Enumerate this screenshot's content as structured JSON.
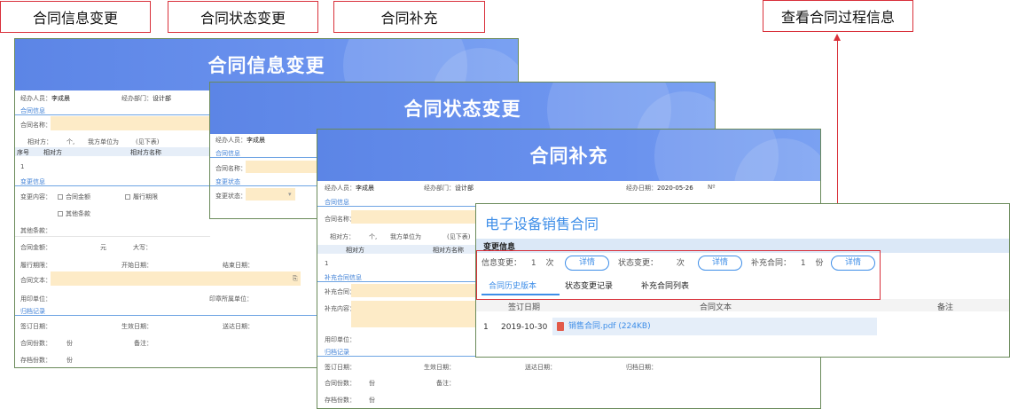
{
  "labels": {
    "info_change": "合同信息变更",
    "status_change": "合同状态变更",
    "supplement": "合同补充",
    "view_process": "查看合同过程信息"
  },
  "panel1": {
    "banner": "合同信息变更",
    "handler_label": "经办人员：",
    "handler": "李成晨",
    "dept_label": "经办部门：",
    "dept": "设计部",
    "sec_contract": "合同信息",
    "contract_name_label": "合同名称：",
    "counterpart_label": "相对方：",
    "counterpart_unit": "个,",
    "our_unit": "我方单位为",
    "see_below": "(见下表)",
    "th_no": "序号",
    "th_party": "相对方",
    "th_party_name": "相对方名称",
    "row_no": "1",
    "sec_change": "变更信息",
    "change_content_label": "变更内容：",
    "cb_amount": "合同金额",
    "cb_period": "履行期限",
    "cb_other": "其他条款",
    "other_label": "其他条款：",
    "amount_label": "合同金额：",
    "yuan": "元",
    "capital_label": "大写：",
    "period_label": "履行期限：",
    "start_label": "开始日期：",
    "end_label": "结束日期：",
    "text_label": "合同文本：",
    "seal_label": "用印单位：",
    "seal_dept_label": "印章所属单位：",
    "sec_archive": "归档记录",
    "sign_label": "签订日期：",
    "effective_label": "生效日期：",
    "deliver_label": "送达日期：",
    "copies_label": "合同份数：",
    "fen": "份",
    "remark_label": "备注：",
    "archive_copies_label": "存档份数："
  },
  "panel2": {
    "banner": "合同状态变更",
    "handler_label": "经办人员：",
    "handler": "李成晨",
    "sec_contract": "合同信息",
    "contract_name_label": "合同名称：",
    "sec_status": "变更状态",
    "status_label": "变更状态："
  },
  "panel3": {
    "banner": "合同补充",
    "handler_label": "经办人员：",
    "handler": "李成晨",
    "dept_label": "经办部门：",
    "dept": "设计部",
    "date_label": "经办日期：",
    "date": "2020-05-26",
    "no_label": "Nº",
    "sec_contract": "合同信息",
    "contract_name_label": "合同名称：",
    "counterpart_label": "相对方：",
    "counterpart_unit": "个,",
    "our_unit": "我方单位为",
    "see_below": "(见下表)",
    "th_party": "相对方",
    "th_party_name": "相对方名称",
    "row_no": "1",
    "sec_supp": "补充合同信息",
    "supp_contract_label": "补充合同：",
    "supp_content_label": "补充内容：",
    "seal_label": "用印单位：",
    "sec_archive": "归档记录",
    "sign_label": "签订日期：",
    "effective_label": "生效日期：",
    "deliver_label": "送达日期：",
    "archive_date_label": "归档日期：",
    "copies_label": "合同份数：",
    "fen": "份",
    "remark_label": "备注：",
    "archive_copies_label": "存档份数："
  },
  "card": {
    "title": "电子设备销售合同",
    "section": "变更信息",
    "info_change_label": "信息变更：",
    "info_change_count": "1",
    "unit_times": "次",
    "detail_btn": "详情",
    "status_change_label": "状态变更：",
    "status_change_count": "",
    "supp_label": "补充合同：",
    "supp_count": "1",
    "unit_fen": "份",
    "tabs": [
      "合同历史版本",
      "状态变更记录",
      "补充合同列表"
    ],
    "columns": [
      "签订日期",
      "合同文本",
      "备注"
    ],
    "row": {
      "no": "1",
      "date": "2019-10-30",
      "file": "销售合同.pdf (224KB)"
    }
  },
  "colors": {
    "banner": "#5c85e6",
    "accent": "#3e8ee8",
    "highlight": "#d9303a",
    "input_fill": "#fdebc7"
  }
}
